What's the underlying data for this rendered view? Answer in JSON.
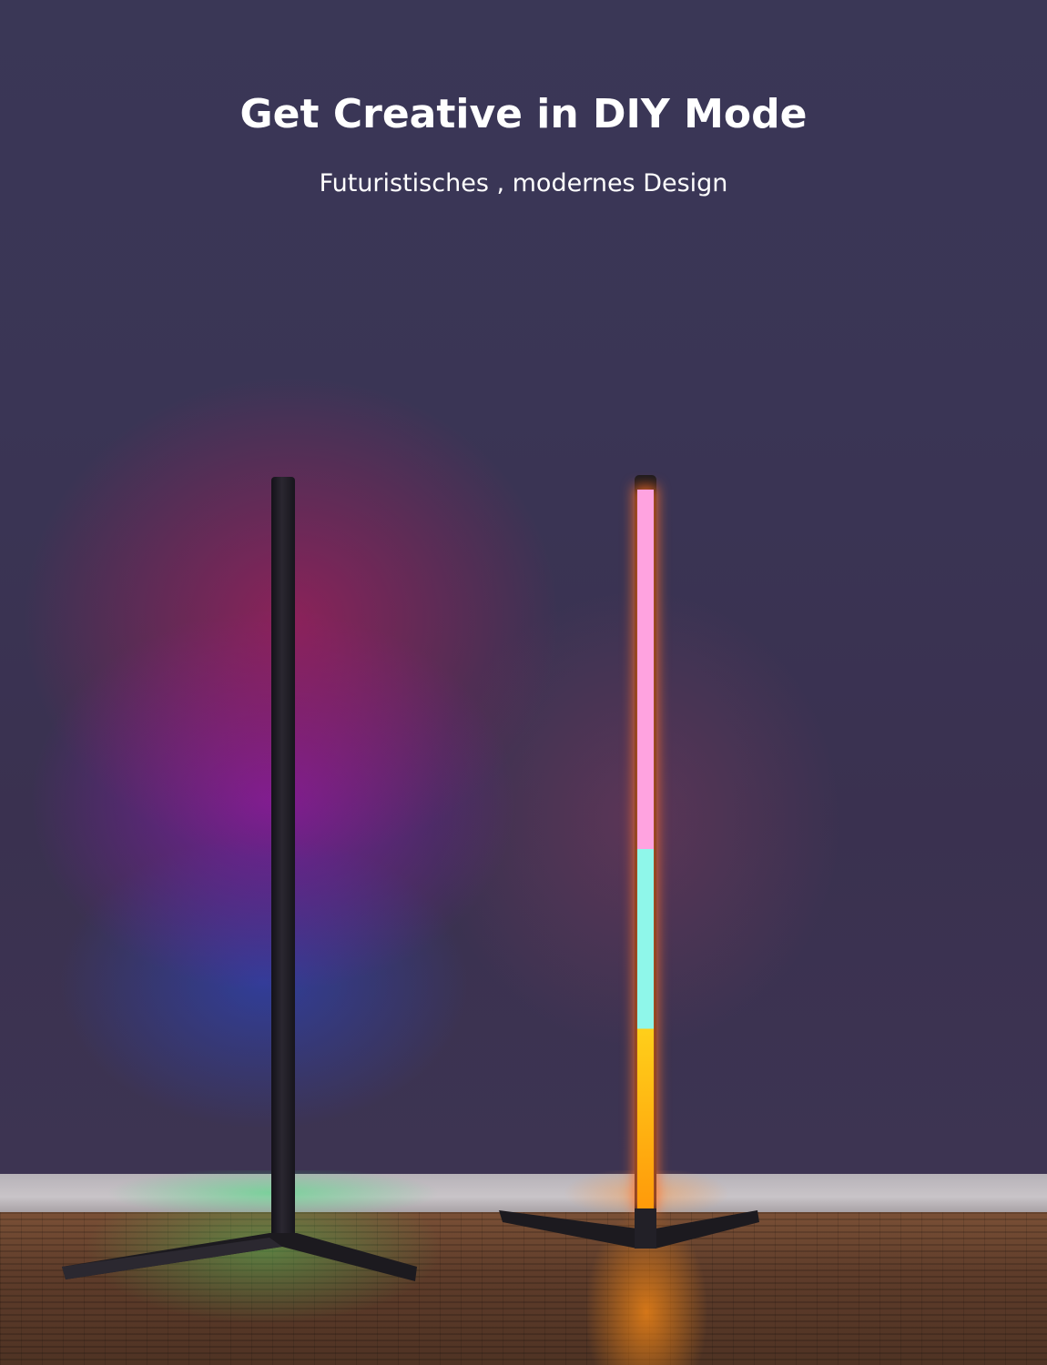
{
  "headline": {
    "title": "Get Creative in DIY Mode",
    "subtitle": "Futuristisches , modernes Design"
  }
}
